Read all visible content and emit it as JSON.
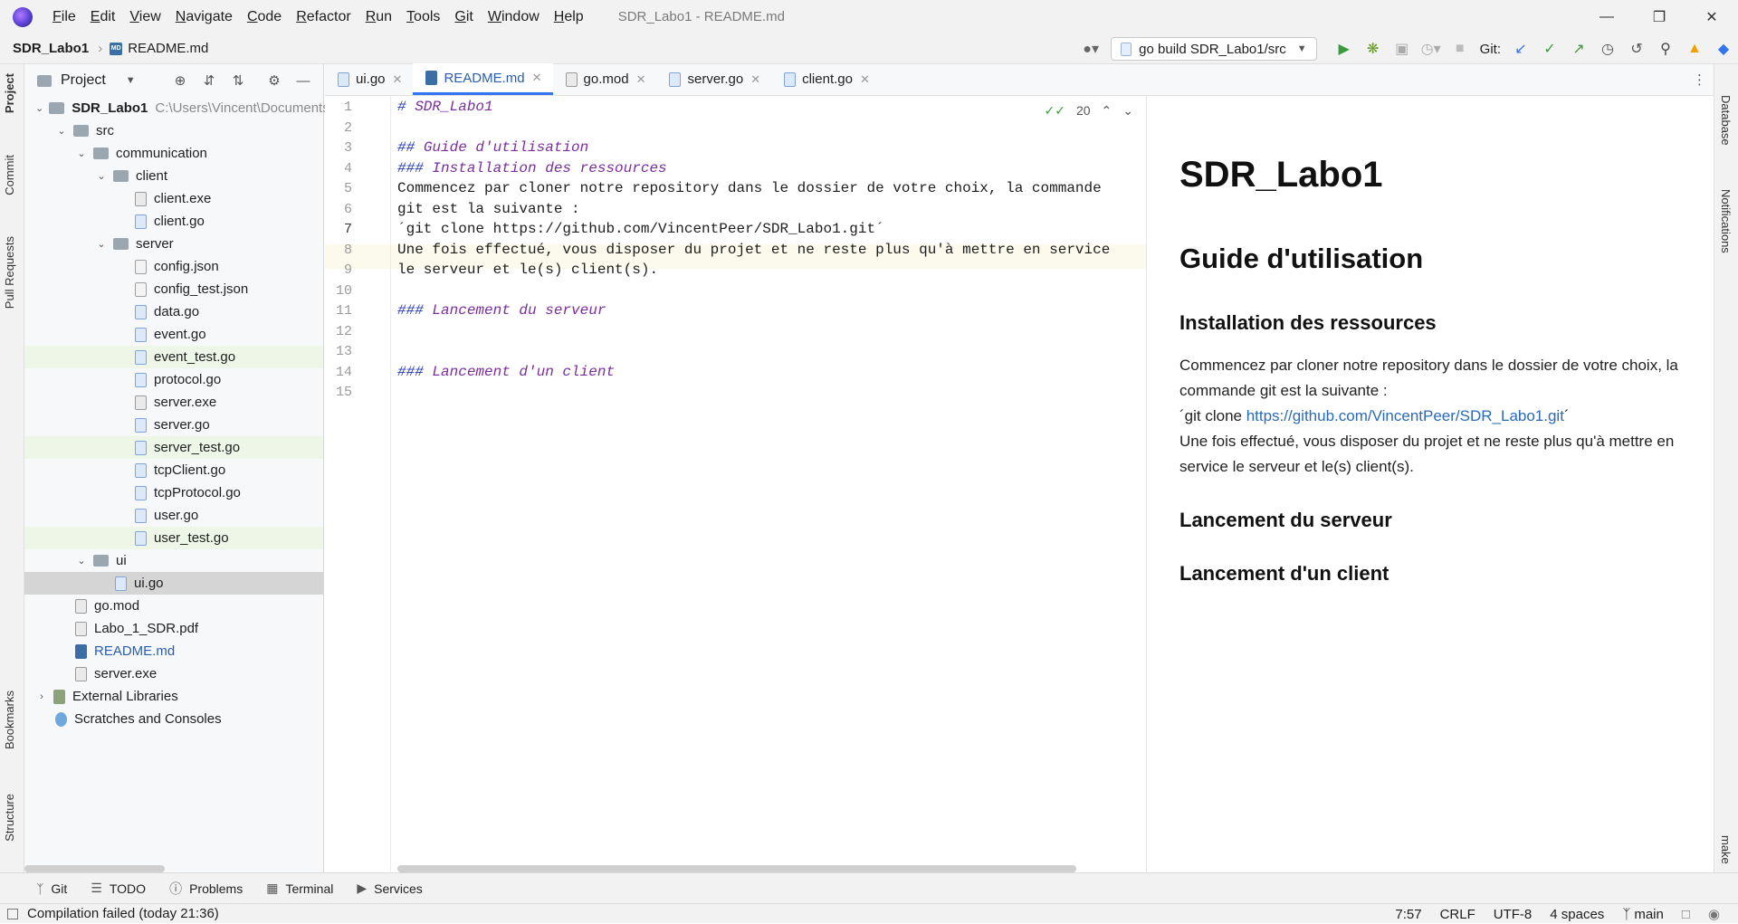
{
  "window": {
    "title": "SDR_Labo1 - README.md"
  },
  "menu": [
    "File",
    "Edit",
    "View",
    "Navigate",
    "Code",
    "Refactor",
    "Run",
    "Tools",
    "Git",
    "Window",
    "Help"
  ],
  "menu_underline": [
    "F",
    "E",
    "V",
    "N",
    "C",
    "R",
    "R",
    "T",
    "G",
    "W",
    "H"
  ],
  "breadcrumb": {
    "root": "SDR_Labo1",
    "file": "README.md"
  },
  "toolbar": {
    "run_config": "go build SDR_Labo1/src",
    "git_label": "Git:"
  },
  "left_tabs": [
    "Project",
    "Commit",
    "Pull Requests",
    "Bookmarks",
    "Structure"
  ],
  "right_tabs": [
    "Database",
    "Notifications",
    "make"
  ],
  "project_panel": {
    "title": "Project",
    "tree": [
      {
        "label": "SDR_Labo1",
        "type": "folder",
        "depth": 0,
        "arrow": "down",
        "suffix": "C:\\Users\\Vincent\\Documents\\"
      },
      {
        "label": "src",
        "type": "folder",
        "depth": 1,
        "arrow": "down"
      },
      {
        "label": "communication",
        "type": "folder",
        "depth": 2,
        "arrow": "down"
      },
      {
        "label": "client",
        "type": "folder",
        "depth": 3,
        "arrow": "down"
      },
      {
        "label": "client.exe",
        "type": "exe",
        "depth": 4
      },
      {
        "label": "client.go",
        "type": "go",
        "depth": 4
      },
      {
        "label": "server",
        "type": "folder",
        "depth": 3,
        "arrow": "down"
      },
      {
        "label": "config.json",
        "type": "json",
        "depth": 4
      },
      {
        "label": "config_test.json",
        "type": "json",
        "depth": 4
      },
      {
        "label": "data.go",
        "type": "go",
        "depth": 4
      },
      {
        "label": "event.go",
        "type": "go",
        "depth": 4
      },
      {
        "label": "event_test.go",
        "type": "go",
        "depth": 4,
        "state": "green"
      },
      {
        "label": "protocol.go",
        "type": "go",
        "depth": 4
      },
      {
        "label": "server.exe",
        "type": "exe",
        "depth": 4
      },
      {
        "label": "server.go",
        "type": "go",
        "depth": 4
      },
      {
        "label": "server_test.go",
        "type": "go",
        "depth": 4,
        "state": "green"
      },
      {
        "label": "tcpClient.go",
        "type": "go",
        "depth": 4
      },
      {
        "label": "tcpProtocol.go",
        "type": "go",
        "depth": 4
      },
      {
        "label": "user.go",
        "type": "go",
        "depth": 4
      },
      {
        "label": "user_test.go",
        "type": "go",
        "depth": 4,
        "state": "green"
      },
      {
        "label": "ui",
        "type": "folder",
        "depth": 2,
        "arrow": "down"
      },
      {
        "label": "ui.go",
        "type": "go",
        "depth": 3,
        "state": "selected"
      },
      {
        "label": "go.mod",
        "type": "exe",
        "depth": 1
      },
      {
        "label": "Labo_1_SDR.pdf",
        "type": "pdf",
        "depth": 1
      },
      {
        "label": "README.md",
        "type": "md",
        "depth": 1,
        "state": "link"
      },
      {
        "label": "server.exe",
        "type": "exe",
        "depth": 1
      },
      {
        "label": "External Libraries",
        "type": "lib",
        "depth": 0,
        "arrow": "right"
      },
      {
        "label": "Scratches and Consoles",
        "type": "scratch",
        "depth": 0
      }
    ]
  },
  "tabs": [
    {
      "label": "ui.go",
      "type": "go",
      "active": false
    },
    {
      "label": "README.md",
      "type": "md",
      "active": true
    },
    {
      "label": "go.mod",
      "type": "exe",
      "active": false
    },
    {
      "label": "server.go",
      "type": "go",
      "active": false
    },
    {
      "label": "client.go",
      "type": "go",
      "active": false
    }
  ],
  "editor": {
    "inspection_count": "20",
    "current_line": 7,
    "lines": [
      {
        "n": "1",
        "text": "SDR_Labo1",
        "hash": "# ",
        "heading": true
      },
      {
        "n": "2",
        "text": ""
      },
      {
        "n": "3",
        "text": "Guide d'utilisation",
        "hash": "## ",
        "heading": true
      },
      {
        "n": "4",
        "text": "Installation des ressources",
        "hash": "### ",
        "heading": true
      },
      {
        "n": "5",
        "text": "Commencez par cloner notre repository dans le dossier de votre choix, la commande"
      },
      {
        "n": "6",
        "text": "git est la suivante :"
      },
      {
        "n": "7",
        "text": "´git clone https://github.com/VincentPeer/SDR_Labo1.git´"
      },
      {
        "n": "8",
        "text": "Une fois effectué, vous disposer du projet et ne reste plus qu'à mettre en service"
      },
      {
        "n": "9",
        "text": "le serveur et le(s) client(s)."
      },
      {
        "n": "10",
        "text": ""
      },
      {
        "n": "11",
        "text": "Lancement du serveur",
        "hash": "### ",
        "heading": true
      },
      {
        "n": "12",
        "text": ""
      },
      {
        "n": "13",
        "text": ""
      },
      {
        "n": "14",
        "text": "Lancement d'un client",
        "hash": "### ",
        "heading": true
      },
      {
        "n": "15",
        "text": ""
      }
    ]
  },
  "preview": {
    "h1": "SDR_Labo1",
    "h2": "Guide d'utilisation",
    "h3_install": "Installation des ressources",
    "p_line1": "Commencez par cloner notre repository dans le dossier de votre choix, la commande git est la suivante :",
    "p_code_prefix": "´git clone ",
    "p_link": "https://github.com/VincentPeer/SDR_Labo1.git",
    "p_code_suffix": "´",
    "p_line3": "Une fois effectué, vous disposer du projet et ne reste plus qu'à mettre en service le serveur et le(s) client(s).",
    "h3_server": "Lancement du serveur",
    "h3_client": "Lancement d'un client"
  },
  "tool_windows": [
    "Git",
    "TODO",
    "Problems",
    "Terminal",
    "Services"
  ],
  "status": {
    "message": "Compilation failed (today 21:36)",
    "position": "7:57",
    "line_sep": "CRLF",
    "encoding": "UTF-8",
    "indent": "4 spaces",
    "branch": "main"
  },
  "colors": {
    "accent": "#3574f0",
    "heading": "#7a2ea0",
    "heading_hash": "#2a3cb0",
    "link": "#2a6ab8",
    "test_row": "#eef7e7"
  }
}
